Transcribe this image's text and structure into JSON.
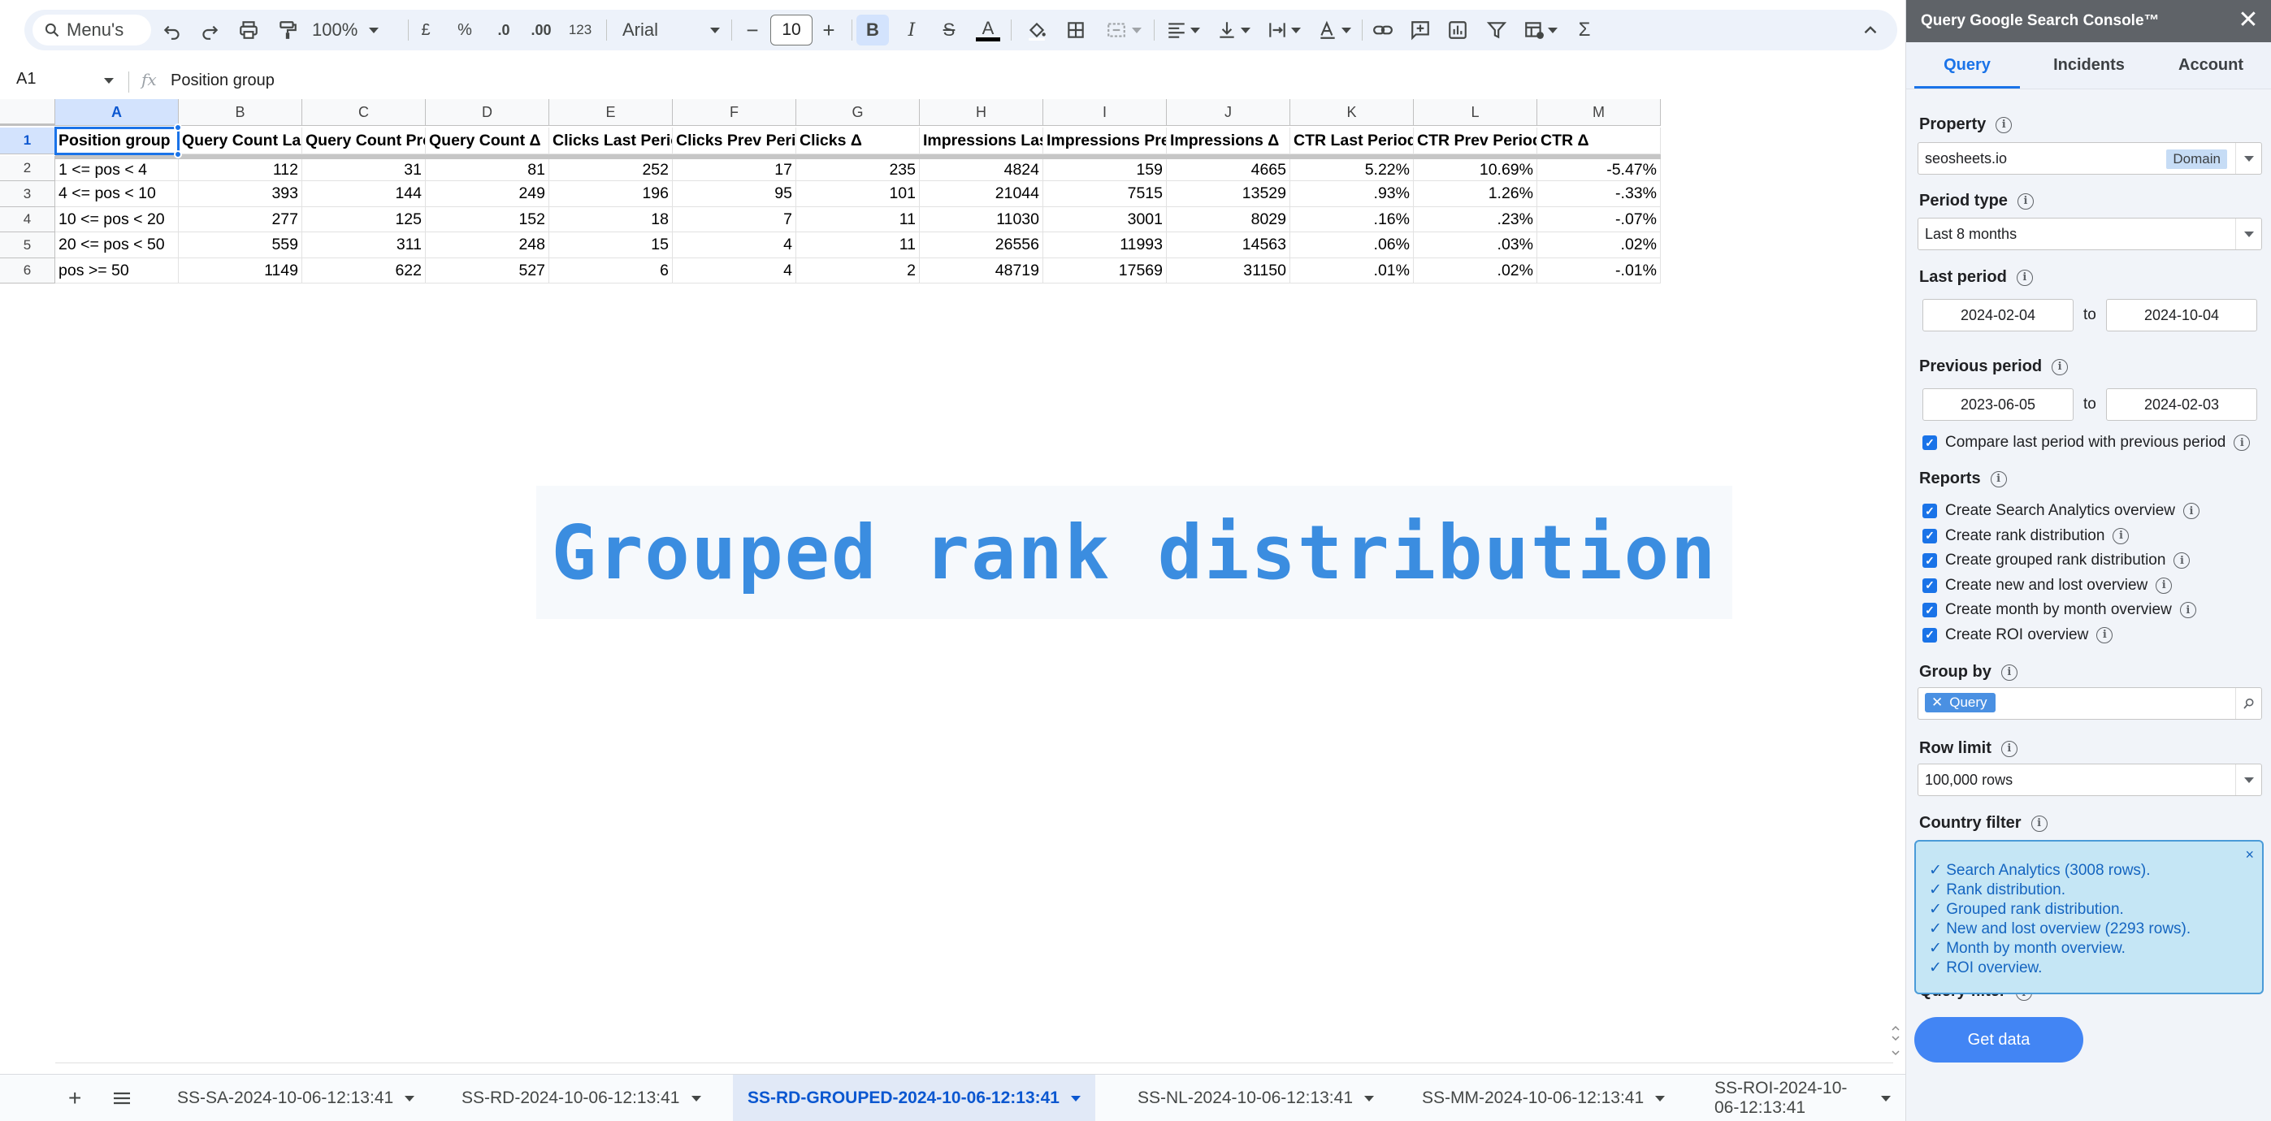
{
  "toolbar": {
    "menus_label": "Menu's",
    "zoom": "100%",
    "currency": "£",
    "percent": "%",
    "decrease_decimals": ".0",
    "increase_decimals": ".00",
    "number_format": "123",
    "font": "Arial",
    "font_size": "10",
    "bold": "B",
    "italic": "I",
    "strikethrough": "S",
    "text_color": "A",
    "function": "Σ"
  },
  "formula_bar": {
    "cell_ref": "A1",
    "fx": "fx",
    "content": "Position group"
  },
  "grid": {
    "columns": [
      "A",
      "B",
      "C",
      "D",
      "E",
      "F",
      "G",
      "H",
      "I",
      "J",
      "K",
      "L",
      "M"
    ],
    "rows": [
      "1",
      "2",
      "3",
      "4",
      "5",
      "6"
    ],
    "header_row": [
      "Position group",
      "Query Count Last Period",
      "Query Count Prev Period",
      "Query Count Δ",
      "Clicks Last Period",
      "Clicks Prev Period",
      "Clicks Δ",
      "Impressions Last Period",
      "Impressions Prev Period",
      "Impressions Δ",
      "CTR Last Period",
      "CTR Prev Period",
      "CTR Δ"
    ],
    "data_rows": [
      [
        "1 <= pos < 4",
        "112",
        "31",
        "81",
        "252",
        "17",
        "235",
        "4824",
        "159",
        "4665",
        "5.22%",
        "10.69%",
        "-5.47%"
      ],
      [
        "4 <= pos < 10",
        "393",
        "144",
        "249",
        "196",
        "95",
        "101",
        "21044",
        "7515",
        "13529",
        ".93%",
        "1.26%",
        "-.33%"
      ],
      [
        "10 <= pos < 20",
        "277",
        "125",
        "152",
        "18",
        "7",
        "11",
        "11030",
        "3001",
        "8029",
        ".16%",
        ".23%",
        "-.07%"
      ],
      [
        "20 <= pos < 50",
        "559",
        "311",
        "248",
        "15",
        "4",
        "11",
        "26556",
        "11993",
        "14563",
        ".06%",
        ".03%",
        ".02%"
      ],
      [
        "pos >= 50",
        "1149",
        "622",
        "527",
        "6",
        "4",
        "2",
        "48719",
        "17569",
        "31150",
        ".01%",
        ".02%",
        "-.01%"
      ]
    ]
  },
  "overlay": {
    "title": "Grouped rank distribution"
  },
  "sheet_tabs": [
    {
      "label": "SS-SA-2024-10-06-12:13:41",
      "active": false
    },
    {
      "label": "SS-RD-2024-10-06-12:13:41",
      "active": false
    },
    {
      "label": "SS-RD-GROUPED-2024-10-06-12:13:41",
      "active": true
    },
    {
      "label": "SS-NL-2024-10-06-12:13:41",
      "active": false
    },
    {
      "label": "SS-MM-2024-10-06-12:13:41",
      "active": false
    },
    {
      "label": "SS-ROI-2024-10-06-12:13:41",
      "active": false
    }
  ],
  "sidebar": {
    "title": "Query Google Search Console™",
    "close": "✕",
    "tabs": [
      "Query",
      "Incidents",
      "Account"
    ],
    "property_label": "Property",
    "property_value": "seosheets.io",
    "property_chip": "Domain",
    "period_type_label": "Period type",
    "period_type_value": "Last 8 months",
    "last_period_label": "Last period",
    "last_period_from": "2024-02-04",
    "last_period_to": "2024-10-04",
    "previous_period_label": "Previous period",
    "previous_period_from": "2023-06-05",
    "previous_period_to": "2024-02-03",
    "to_label": "to",
    "compare_label": "Compare last period with previous period",
    "reports_label": "Reports",
    "reports": [
      "Create Search Analytics overview",
      "Create rank distribution",
      "Create grouped rank distribution",
      "Create new and lost overview",
      "Create month by month overview",
      "Create ROI overview"
    ],
    "group_by_label": "Group by",
    "group_by_chip": "Query",
    "row_limit_label": "Row limit",
    "row_limit_value": "100,000 rows",
    "country_filter_label": "Country filter",
    "query_filter_label": "Query filter",
    "notification": [
      "✓ Search Analytics (3008 rows).",
      "✓ Rank distribution.",
      "✓ Grouped rank distribution.",
      "✓ New and lost overview (2293 rows).",
      "✓ Month by month overview.",
      "✓ ROI overview."
    ],
    "notification_close": "×",
    "get_data_label": "Get data"
  },
  "colors": {
    "accent": "#1a73e8",
    "toolbar_bg": "#edf2fa",
    "sidebar_bg": "#f1f4f9",
    "sidebar_header": "#5f6368",
    "overlay_text": "#3b8de0",
    "notification_bg": "#c5e6f5"
  }
}
